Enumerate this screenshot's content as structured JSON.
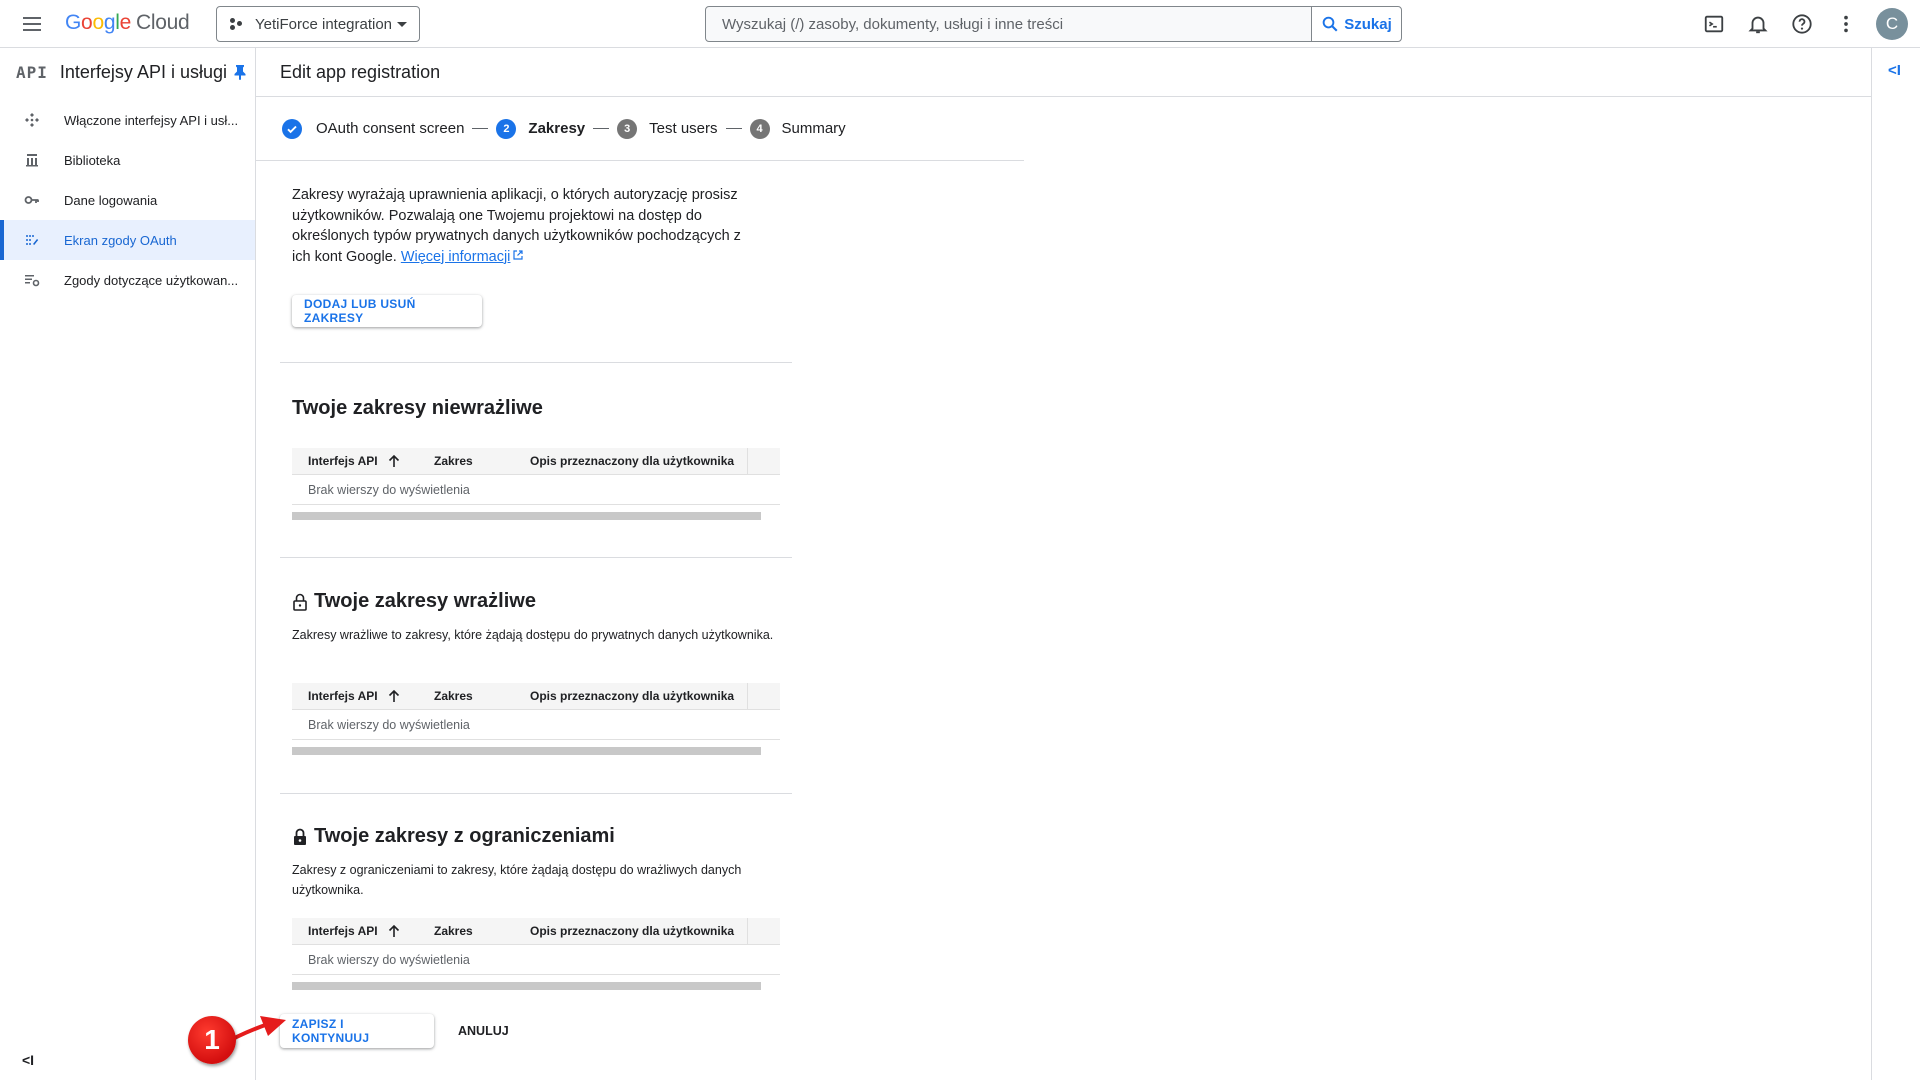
{
  "header": {
    "logo_google": [
      "G",
      "o",
      "o",
      "g",
      "l",
      "e"
    ],
    "logo_cloud": "Cloud",
    "project": "YetiForce integration",
    "search_placeholder": "Wyszukaj (/) zasoby, dokumenty, usługi i inne treści",
    "search_value": "",
    "search_button": "Szukaj",
    "avatar_initial": "C",
    "icons": [
      "cloud-shell-icon",
      "notifications-icon",
      "help-icon",
      "more-vert-icon"
    ]
  },
  "sidebar": {
    "badge": "API",
    "title": "Interfejsy API i usługi",
    "items": [
      {
        "label": "Włączone interfejsy API i usł...",
        "icon": "apis-icon",
        "active": false
      },
      {
        "label": "Biblioteka",
        "icon": "library-icon",
        "active": false
      },
      {
        "label": "Dane logowania",
        "icon": "key-icon",
        "active": false
      },
      {
        "label": "Ekran zgody OAuth",
        "icon": "consent-icon",
        "active": true
      },
      {
        "label": "Zgody dotyczące użytkowan...",
        "icon": "settings-list-icon",
        "active": false
      }
    ],
    "collapse_label": "<I"
  },
  "page": {
    "title": "Edit app registration",
    "expand_label": "<I"
  },
  "stepper": {
    "steps": [
      {
        "num": "1",
        "label": "OAuth consent screen",
        "state": "done"
      },
      {
        "num": "2",
        "label": "Zakresy",
        "state": "current"
      },
      {
        "num": "3",
        "label": "Test users",
        "state": "pending"
      },
      {
        "num": "4",
        "label": "Summary",
        "state": "pending"
      }
    ]
  },
  "intro": {
    "text": "Zakresy wyrażają uprawnienia aplikacji, o których autoryzację prosisz użytkowników. Pozwalają one Twojemu projektowi na dostęp do określonych typów prywatnych danych użytkowników pochodzących z ich kont Google.",
    "link": "Więcej informacji",
    "add_button": "DODAJ LUB USUŃ ZAKRESY"
  },
  "table_columns": [
    "Interfejs API",
    "Zakres",
    "Opis przeznaczony dla użytkownika"
  ],
  "sections": [
    {
      "title": "Twoje zakresy niewrażliwe",
      "description": "",
      "icon": "",
      "empty": "Brak wierszy do wyświetlenia"
    },
    {
      "title": "Twoje zakresy wrażliwe",
      "description": "Zakresy wrażliwe to zakresy, które żądają dostępu do prywatnych danych użytkownika.",
      "icon": "lock-open-outline-icon",
      "empty": "Brak wierszy do wyświetlenia"
    },
    {
      "title": "Twoje zakresy z ograniczeniami",
      "description": "Zakresy z ograniczeniami to zakresy, które żądają dostępu do wrażliwych danych użytkownika.",
      "icon": "lock-filled-icon",
      "empty": "Brak wierszy do wyświetlenia"
    }
  ],
  "actions": {
    "save": "ZAPISZ I KONTYNUUJ",
    "cancel": "ANULUJ"
  },
  "annotation": {
    "number": "1",
    "color": "#e51c1c"
  },
  "colors": {
    "accent": "#1a73e8",
    "active_nav_bg": "#e8f0fe",
    "divider": "#dadce0"
  }
}
